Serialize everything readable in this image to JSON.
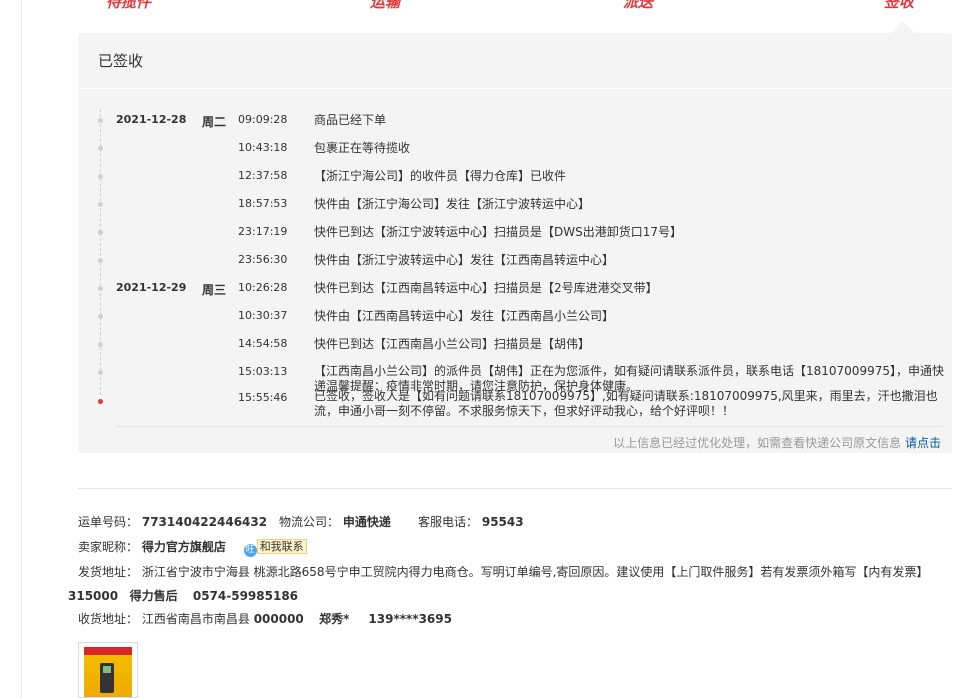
{
  "steps": [
    "待揽件",
    "运输",
    "派送",
    "签收"
  ],
  "panel": {
    "title": "已签收",
    "footer_note": "以上信息已经过优化处理，如需查看快递公司原文信息",
    "footer_link": "请点击"
  },
  "tracking": [
    {
      "date": "2021-12-28",
      "weekday": "周二",
      "time": "09:09:28",
      "msg": "商品已经下单"
    },
    {
      "date": "",
      "weekday": "",
      "time": "10:43:18",
      "msg": "包裹正在等待揽收"
    },
    {
      "date": "",
      "weekday": "",
      "time": "12:37:58",
      "msg": "【浙江宁海公司】的收件员【得力仓库】已收件"
    },
    {
      "date": "",
      "weekday": "",
      "time": "18:57:53",
      "msg": "快件由【浙江宁海公司】发往【浙江宁波转运中心】"
    },
    {
      "date": "",
      "weekday": "",
      "time": "23:17:19",
      "msg": "快件已到达【浙江宁波转运中心】扫描员是【DWS出港卸货口17号】"
    },
    {
      "date": "",
      "weekday": "",
      "time": "23:56:30",
      "msg": "快件由【浙江宁波转运中心】发往【江西南昌转运中心】"
    },
    {
      "date": "2021-12-29",
      "weekday": "周三",
      "time": "10:26:28",
      "msg": "快件已到达【江西南昌转运中心】扫描员是【2号库进港交叉带】"
    },
    {
      "date": "",
      "weekday": "",
      "time": "10:30:37",
      "msg": "快件由【江西南昌转运中心】发往【江西南昌小兰公司】"
    },
    {
      "date": "",
      "weekday": "",
      "time": "14:54:58",
      "msg": "快件已到达【江西南昌小兰公司】扫描员是【胡伟】"
    },
    {
      "date": "",
      "weekday": "",
      "time": "15:03:13",
      "msg": "【江西南昌小兰公司】的派件员【胡伟】正在为您派件，如有疑问请联系派件员，联系电话【18107009975】，申通快递温馨提醒：疫情非常时期，请您注意防护，保护身体健康。"
    },
    {
      "date": "",
      "weekday": "",
      "time": "15:55:46",
      "msg": "已签收，签收人是【如有问题请联系18107009975】,如有疑问请联系:18107009975,风里来，雨里去，汗也撒泪也流，申通小哥一刻不停留。不求服务惊天下，但求好评动我心，给个好评呗！！"
    }
  ],
  "order": {
    "waybill_label": "运单号码：",
    "waybill": "773140422446432",
    "carrier_label": "物流公司：",
    "carrier": "申通快递",
    "phone_label": "客服电话：",
    "phone": "95543",
    "seller_label": "卖家昵称：",
    "seller": "得力官方旗舰店",
    "contact_icon": "旺",
    "contact": "和我联系",
    "ship_label": "发货地址：",
    "ship_address": "浙江省宁波市宁海县 桃源北路658号宁申工贸院内得力电商仓。写明订单编号,寄回原因。建议使用【上门取件服务】若有发票须外箱写【内有发票】",
    "ship_zip": "315000",
    "ship_name": "得力售后",
    "ship_phone": "0574-59985186",
    "recv_label": "收货地址：",
    "recv_address": "江西省南昌市南昌县",
    "recv_zip": "000000",
    "recv_name": "郑秀*",
    "recv_phone": "139****3695"
  },
  "colors": {
    "accent": "#e4393c",
    "panel_bg": "#f4f4f4",
    "link": "#005aa0"
  }
}
